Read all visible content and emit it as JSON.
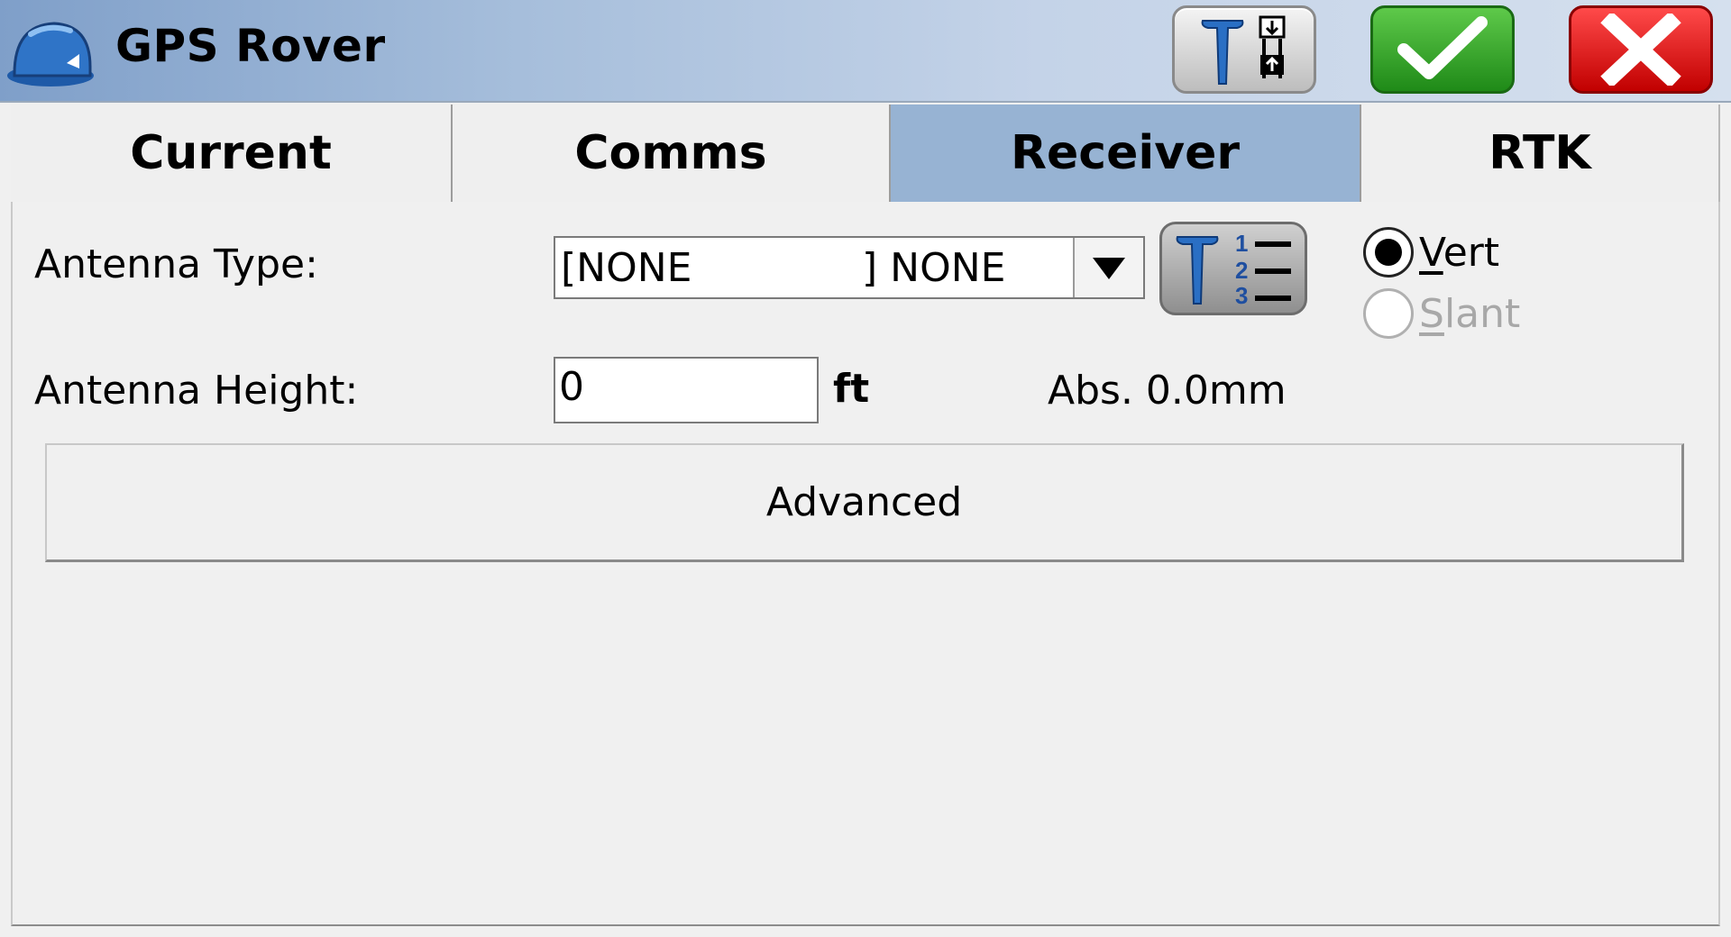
{
  "window": {
    "title": "GPS Rover"
  },
  "header": {
    "app_icon": "hard-hat-icon",
    "buttons": {
      "rover": "rover-antenna-icon",
      "ok": "checkmark-icon",
      "close": "close-x-icon"
    }
  },
  "tabs": [
    {
      "label": "Current",
      "active": false
    },
    {
      "label": "Comms",
      "active": false
    },
    {
      "label": "Receiver",
      "active": true
    },
    {
      "label": "RTK",
      "active": false
    }
  ],
  "receiver": {
    "antenna_type_label": "Antenna Type:",
    "antenna_type_value_left": "[NONE",
    "antenna_type_value_right": "] NONE",
    "antenna_height_label": "Antenna Height:",
    "antenna_height_value": "0",
    "antenna_height_unit": "ft",
    "abs_readout": "Abs. 0.0mm",
    "measure": {
      "options": [
        {
          "label": "Vert",
          "selected": true,
          "enabled": true
        },
        {
          "label": "Slant",
          "selected": false,
          "enabled": false
        }
      ]
    },
    "advanced_label": "Advanced"
  },
  "colors": {
    "active_tab": "#97b3d3",
    "ok_green": "#2ea321",
    "close_red": "#e00000"
  }
}
